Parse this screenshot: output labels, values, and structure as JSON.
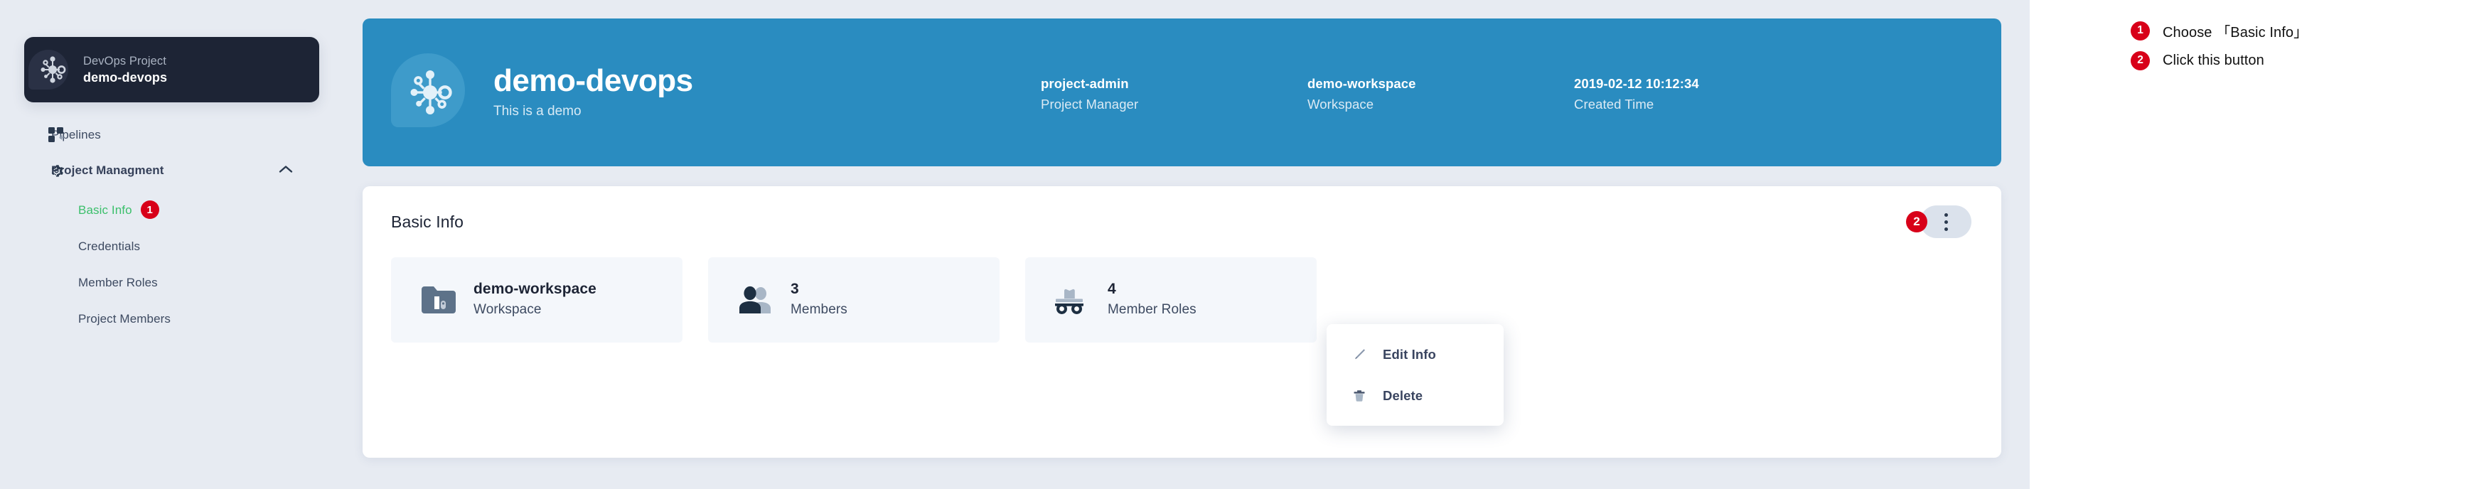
{
  "sidebar": {
    "project_card": {
      "label": "DevOps Project",
      "name": "demo-devops",
      "logo_icon": "devops-network-logo-icon"
    },
    "items": [
      {
        "label": "Pipelines",
        "icon": "pipelines-grid-icon"
      },
      {
        "label": "Project Managment",
        "icon": "gear-icon",
        "chevron": "chevron-up-icon"
      }
    ],
    "sub_items": [
      {
        "label": "Basic Info",
        "active": true,
        "badge": "1"
      },
      {
        "label": "Credentials",
        "active": false
      },
      {
        "label": "Member Roles",
        "active": false
      },
      {
        "label": "Project Members",
        "active": false
      }
    ]
  },
  "hero": {
    "logo_icon": "devops-network-logo-icon",
    "title": "demo-devops",
    "subtitle": "This is a demo",
    "metas": [
      {
        "value": "project-admin",
        "key": "Project Manager"
      },
      {
        "value": "demo-workspace",
        "key": "Workspace"
      },
      {
        "value": "2019-02-12 10:12:34",
        "key": "Created Time"
      }
    ]
  },
  "panel": {
    "title": "Basic Info",
    "badge": "2",
    "kebab_icon": "more-vertical-icon",
    "stats": [
      {
        "icon": "workspace-folder-icon",
        "value": "demo-workspace",
        "key": "Workspace"
      },
      {
        "icon": "members-people-icon",
        "value": "3",
        "key": "Members"
      },
      {
        "icon": "member-roles-incognito-icon",
        "value": "4",
        "key": "Member Roles"
      }
    ]
  },
  "dropdown": {
    "items": [
      {
        "label": "Edit Info",
        "icon": "pencil-icon"
      },
      {
        "label": "Delete",
        "icon": "trash-icon"
      }
    ]
  },
  "annotations": [
    {
      "badge": "1",
      "text": "Choose 「Basic Info」"
    },
    {
      "badge": "2",
      "text": "Click this button"
    }
  ],
  "colors": {
    "accent_blue": "#2a8cc0",
    "badge_red": "#d80019",
    "active_green": "#3bbf6b",
    "dark_navy": "#1d2435",
    "app_bg": "#e7ebf2"
  }
}
